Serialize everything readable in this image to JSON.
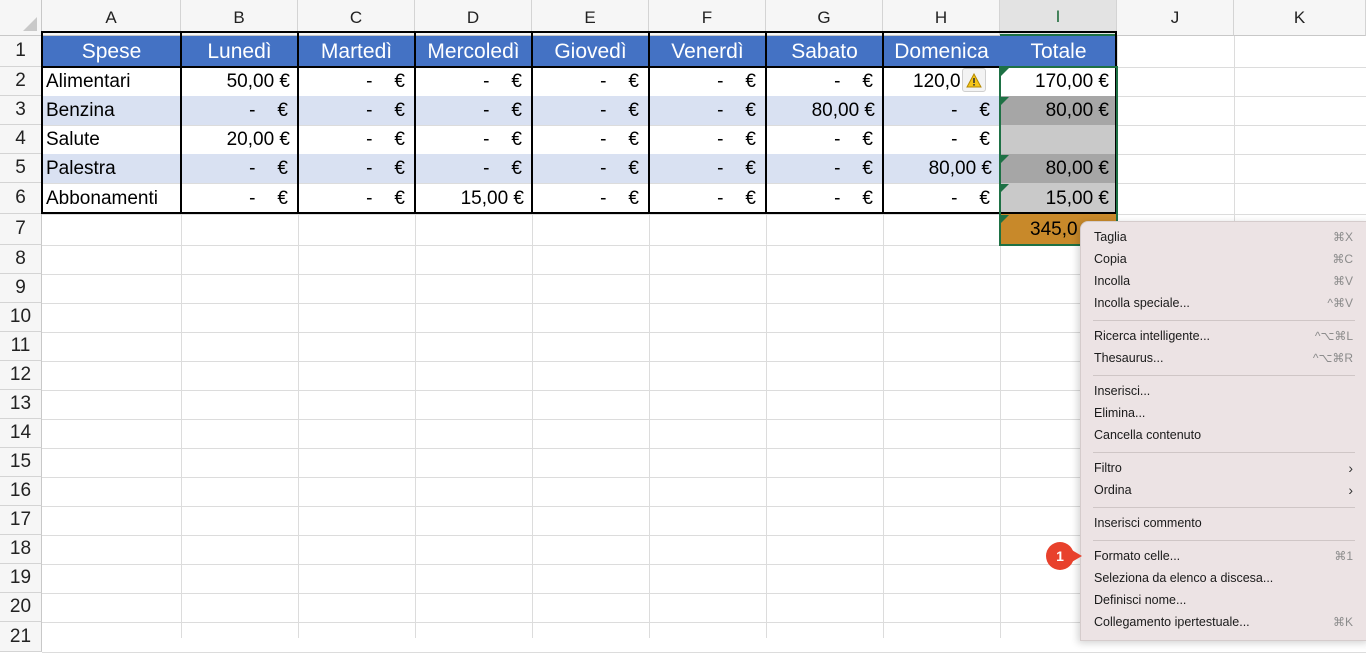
{
  "columns": [
    "A",
    "B",
    "C",
    "D",
    "E",
    "F",
    "G",
    "H",
    "I",
    "J",
    "K"
  ],
  "rows": [
    "1",
    "2",
    "3",
    "4",
    "5",
    "6",
    "7",
    "8",
    "9",
    "10",
    "11",
    "12",
    "13",
    "14",
    "15",
    "16",
    "17",
    "18",
    "19",
    "20",
    "21"
  ],
  "table": {
    "headers": [
      "Spese",
      "Lunedì",
      "Martedì",
      "Mercoledì",
      "Giovedì",
      "Venerdì",
      "Sabato",
      "Domenica",
      "Totale"
    ],
    "rows": [
      {
        "label": "Alimentari",
        "values": [
          "50,00 €",
          "-",
          "-",
          "-",
          "-",
          "-",
          "120,0",
          "170,00 €"
        ]
      },
      {
        "label": "Benzina",
        "values": [
          "-",
          "-",
          "-",
          "-",
          "-",
          "80,00 €",
          "-",
          "80,00 €"
        ]
      },
      {
        "label": "Salute",
        "values": [
          "20,00 €",
          "-",
          "-",
          "-",
          "-",
          "-",
          "-",
          ""
        ]
      },
      {
        "label": "Palestra",
        "values": [
          "-",
          "-",
          "-",
          "-",
          "-",
          "-",
          "80,00 €",
          "80,00 €"
        ]
      },
      {
        "label": "Abbonamenti",
        "values": [
          "-",
          "-",
          "15,00 €",
          "-",
          "-",
          "-",
          "-",
          "15,00 €"
        ]
      }
    ],
    "total_row": {
      "value": "345,0"
    }
  },
  "icons": {
    "warning": "warning-triangle-icon"
  },
  "colors": {
    "header_blue": "#4472c4",
    "band": "#d9e1f2",
    "selection_green": "#1e7145",
    "total_orange": "#c8892a"
  },
  "context_menu": {
    "items": [
      {
        "label": "Taglia",
        "shortcut": "⌘X"
      },
      {
        "label": "Copia",
        "shortcut": "⌘C"
      },
      {
        "label": "Incolla",
        "shortcut": "⌘V"
      },
      {
        "label": "Incolla speciale...",
        "shortcut": "^⌘V"
      },
      {
        "label": "Ricerca intelligente...",
        "shortcut": "^⌥⌘L"
      },
      {
        "label": "Thesaurus...",
        "shortcut": "^⌥⌘R"
      },
      {
        "label": "Inserisci...",
        "shortcut": ""
      },
      {
        "label": "Elimina...",
        "shortcut": ""
      },
      {
        "label": "Cancella contenuto",
        "shortcut": ""
      },
      {
        "label": "Filtro",
        "shortcut": "›"
      },
      {
        "label": "Ordina",
        "shortcut": "›"
      },
      {
        "label": "Inserisci commento",
        "shortcut": ""
      },
      {
        "label": "Formato celle...",
        "shortcut": "⌘1"
      },
      {
        "label": "Seleziona da elenco a discesa...",
        "shortcut": ""
      },
      {
        "label": "Definisci nome...",
        "shortcut": ""
      },
      {
        "label": "Collegamento ipertestuale...",
        "shortcut": "⌘K"
      }
    ]
  },
  "callout": {
    "number": "1"
  }
}
